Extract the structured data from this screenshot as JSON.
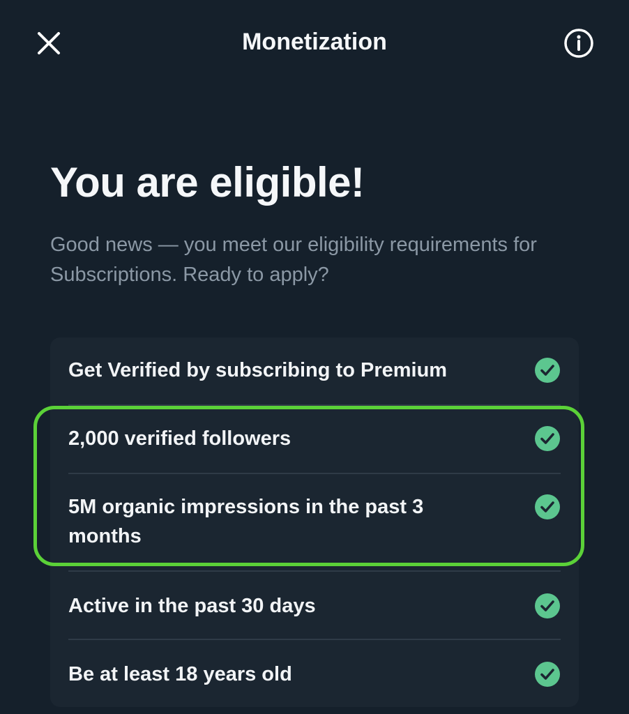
{
  "header": {
    "title": "Monetization",
    "close_icon": "close-icon",
    "info_icon": "info-icon"
  },
  "hero": {
    "title": "You are eligible!",
    "subtitle": "Good news — you meet our eligibility requirements for Subscriptions. Ready to apply?"
  },
  "requirements": [
    {
      "label": "Get Verified by subscribing to Premium",
      "met": true
    },
    {
      "label": "2,000 verified followers",
      "met": true
    },
    {
      "label": "5M organic impressions in the past 3 months",
      "met": true
    },
    {
      "label": "Active in the past 30 days",
      "met": true
    },
    {
      "label": "Be at least 18 years old",
      "met": true
    }
  ],
  "colors": {
    "background": "#15202b",
    "card": "#1b2631",
    "check": "#5cc68f",
    "highlight": "#5bd138",
    "subtitle": "#8b98a5"
  }
}
